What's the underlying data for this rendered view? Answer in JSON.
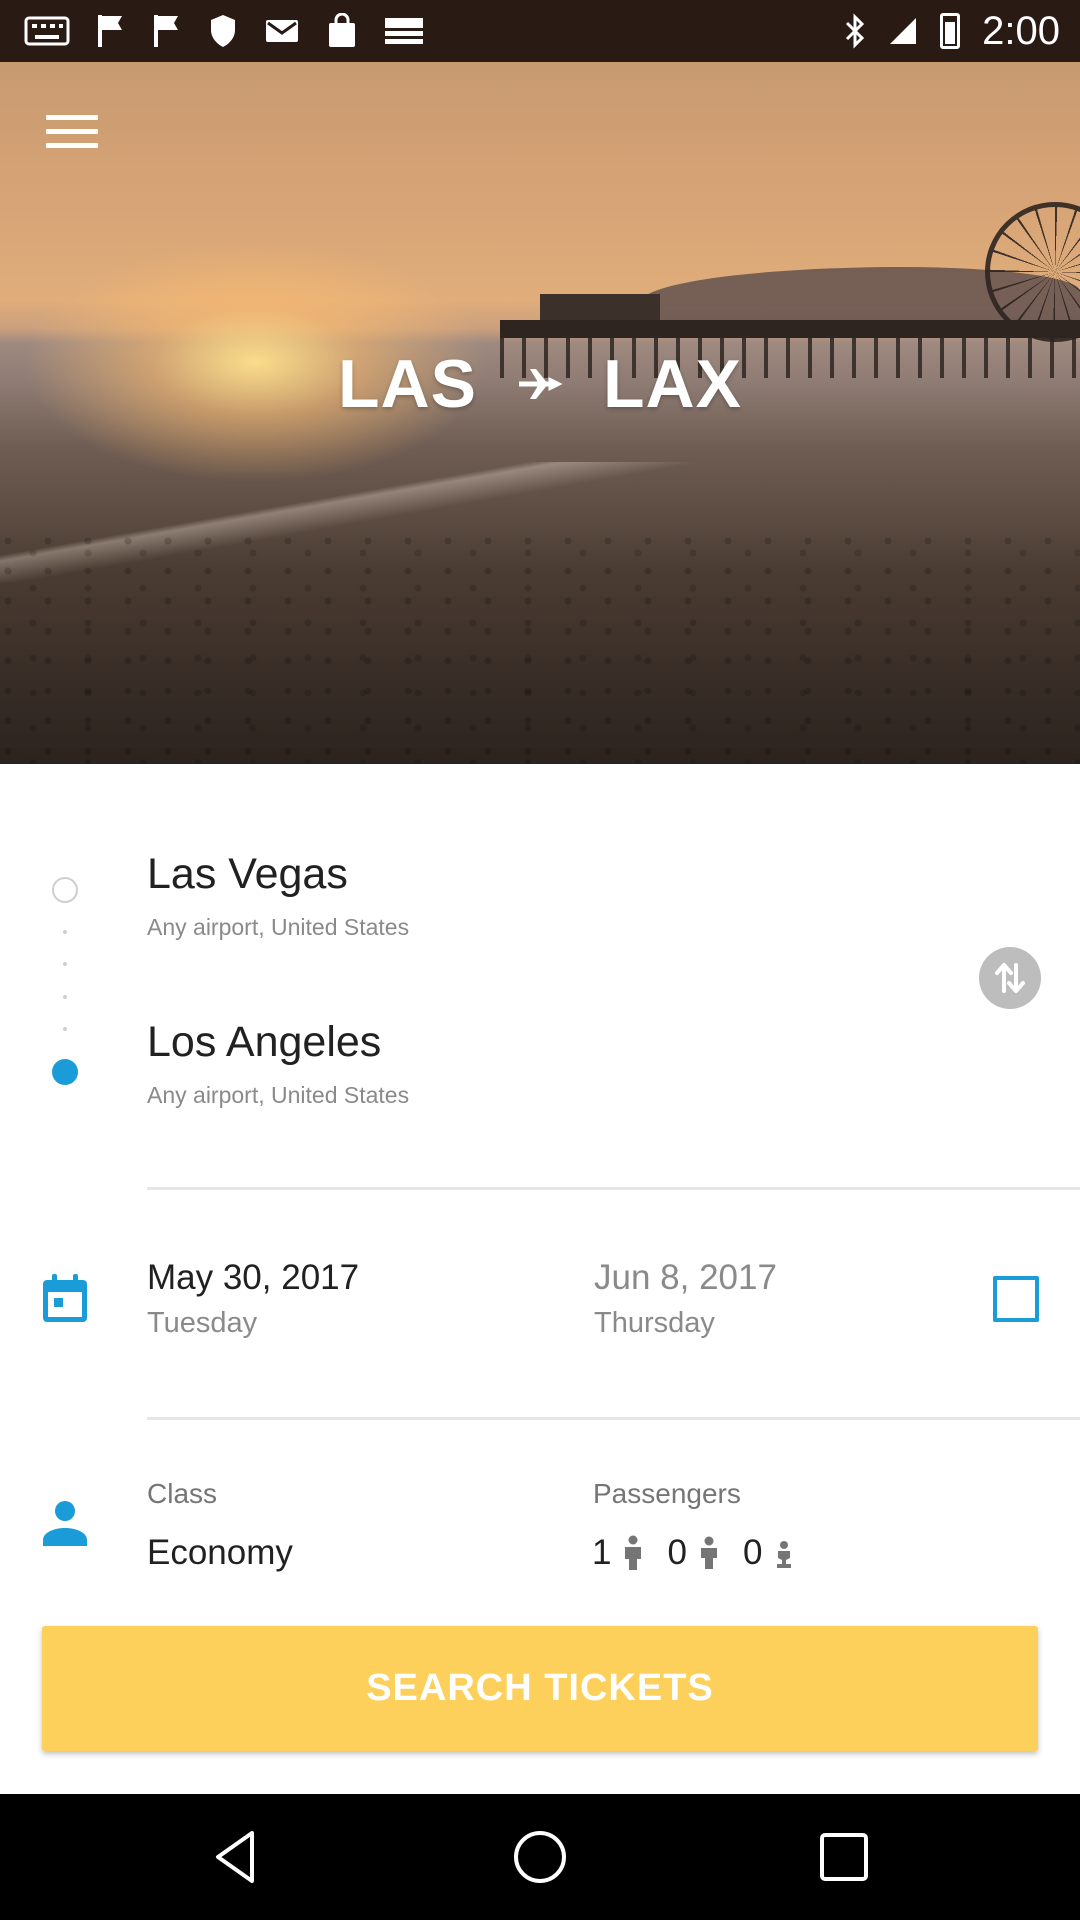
{
  "status_bar": {
    "time": "2:00",
    "icons": [
      "keyboard-icon",
      "flag-icon",
      "flag-icon",
      "shield-icon",
      "email-icon",
      "shopping-bag-icon",
      "espn-icon",
      "bluetooth-icon",
      "signal-icon",
      "battery-icon"
    ]
  },
  "hero": {
    "origin_code": "LAS",
    "destination_code": "LAX"
  },
  "route": {
    "origin": {
      "city": "Las Vegas",
      "airport": "Any airport, United States"
    },
    "destination": {
      "city": "Los Angeles",
      "airport": "Any airport, United States"
    }
  },
  "dates": {
    "depart_date": "May 30, 2017",
    "depart_day": "Tuesday",
    "return_date": "Jun 8, 2017",
    "return_day": "Thursday"
  },
  "trip": {
    "class_label": "Class",
    "class_value": "Economy",
    "passengers_label": "Passengers",
    "adults": "1",
    "children": "0",
    "infants": "0"
  },
  "actions": {
    "search_label": "SEARCH TICKETS"
  },
  "colors": {
    "accent": "#1a9cd8",
    "button": "#fdd05b"
  }
}
